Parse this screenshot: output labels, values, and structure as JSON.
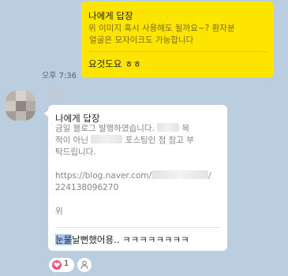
{
  "my_message": {
    "reply_header": "나에게 답장",
    "quoted_lines": [
      "위 이미지 혹시 사용해도 될까요~? 환자분",
      "얼굴은 모자이크도 가능합니다"
    ],
    "text": "요것도요 ㅎㅎ"
  },
  "timestamp": "오후 7:36",
  "their_message": {
    "reply_header": "나에게 답장",
    "quoted_line_1_a": "금일 블로그 발행하였습니다.",
    "quoted_line_1_b": "목",
    "quoted_line_2_a": "적이 아닌",
    "quoted_line_2_b": "포스팅인 점 참고 부",
    "quoted_line_3": "탁드립니다.",
    "quoted_link_a": "https://blog.naver.com/",
    "quoted_link_b": "/",
    "quoted_link_2": "224138096270",
    "quoted_tail": "위",
    "text_highlight": "눈물",
    "text_rest": "날뻔했어용.. ㅋㅋㅋㅋㅋㅋㅋㅋ"
  },
  "reaction": {
    "count": "1",
    "color": "#f25071"
  },
  "colors": {
    "background": "#bacee0",
    "my_bubble": "#fee500",
    "their_bubble": "#ffffff"
  }
}
